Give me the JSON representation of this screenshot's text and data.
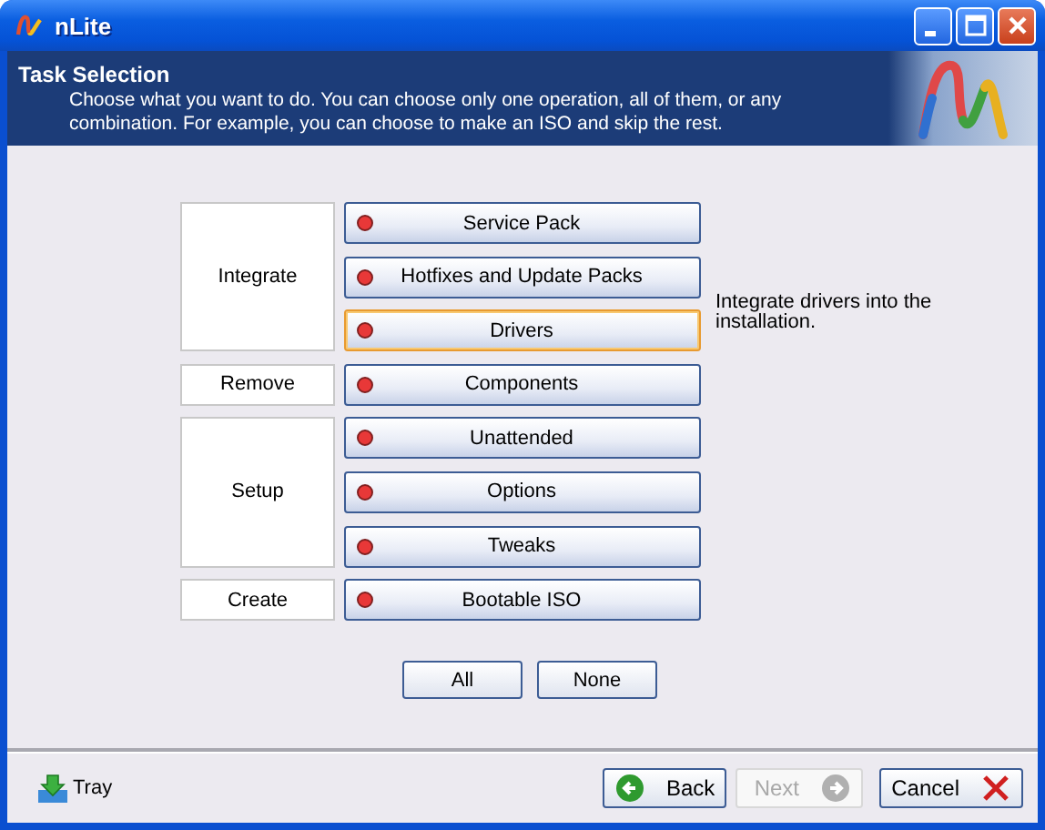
{
  "window": {
    "title": "nLite"
  },
  "header": {
    "title": "Task Selection",
    "description": "Choose what you want to do. You can choose only one operation, all of them, or any combination. For example, you can choose to make an ISO and skip the rest."
  },
  "groups": [
    {
      "label": "Integrate",
      "tasks": [
        {
          "label": "Service Pack",
          "selected": false,
          "focused": false
        },
        {
          "label": "Hotfixes and Update Packs",
          "selected": false,
          "focused": false
        },
        {
          "label": "Drivers",
          "selected": false,
          "focused": true,
          "description": "Integrate drivers into the installation."
        }
      ]
    },
    {
      "label": "Remove",
      "tasks": [
        {
          "label": "Components",
          "selected": false,
          "focused": false
        }
      ]
    },
    {
      "label": "Setup",
      "tasks": [
        {
          "label": "Unattended",
          "selected": false,
          "focused": false
        },
        {
          "label": "Options",
          "selected": false,
          "focused": false
        },
        {
          "label": "Tweaks",
          "selected": false,
          "focused": false
        }
      ]
    },
    {
      "label": "Create",
      "tasks": [
        {
          "label": "Bootable ISO",
          "selected": false,
          "focused": false
        }
      ]
    }
  ],
  "selection_buttons": [
    "All",
    "None"
  ],
  "footer": {
    "tray": "Tray",
    "buttons": [
      {
        "label": "Back",
        "kind": "back",
        "disabled": false
      },
      {
        "label": "Next",
        "kind": "next",
        "disabled": true
      },
      {
        "label": "Cancel",
        "kind": "cancel",
        "disabled": false
      }
    ]
  }
}
